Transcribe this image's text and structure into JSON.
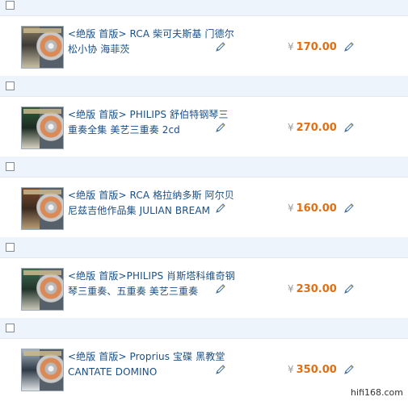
{
  "currency_symbol": "¥",
  "watermark": "hifi168.com",
  "items": [
    {
      "title_line1": "<绝版 首版> RCA 柴可夫斯基 门德尔",
      "title_line2": "松小协 海菲茨",
      "price": "170.00"
    },
    {
      "title_line1": "<绝版 首版> PHILIPS 舒伯特钢琴三",
      "title_line2": "重奏全集 美艺三重奏 2cd",
      "price": "270.00"
    },
    {
      "title_line1": "<绝版 首版> RCA 格拉纳多斯 阿尔贝",
      "title_line2": "尼兹吉他作品集 JULIAN BREAM",
      "price": "160.00"
    },
    {
      "title_line1": "<绝版 首版>PHILIPS 肖斯塔科维奇钢",
      "title_line2": "琴三重奏、五重奏 美艺三重奏",
      "price": "230.00"
    },
    {
      "title_line1": "<绝版 首版> Proprius 宝碟 黑教堂",
      "title_line2": "CANTATE DOMINO",
      "price": "350.00"
    }
  ],
  "icons": {
    "edit": "edit-pencil-icon",
    "checkbox": "checkbox"
  },
  "colors": {
    "title": "#1a4f86",
    "price": "#e06f13",
    "header_row": "#eef4fb"
  }
}
